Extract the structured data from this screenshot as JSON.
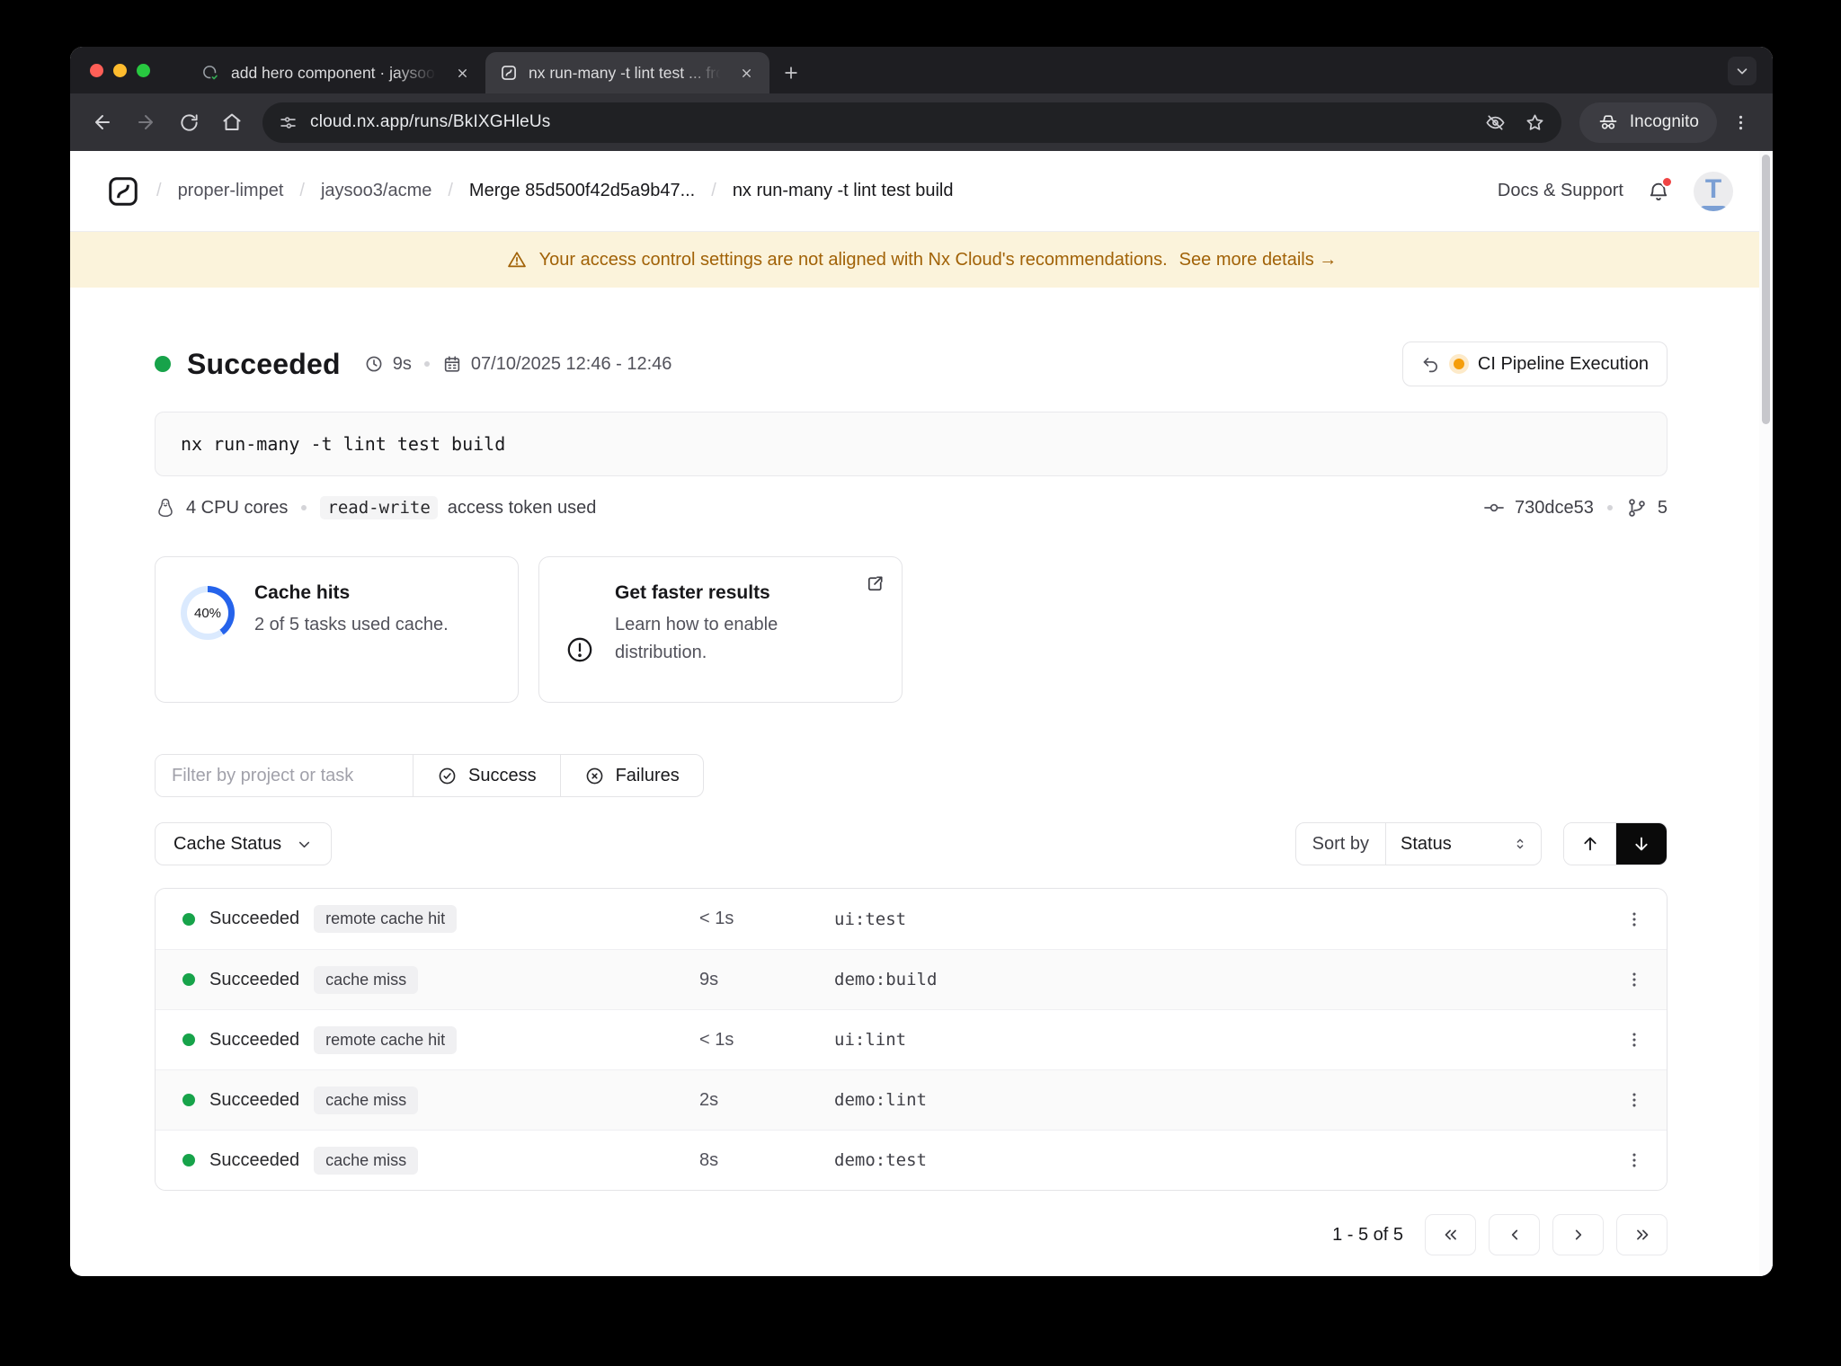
{
  "browser": {
    "tab1": {
      "title": "add hero component · jaysoo"
    },
    "tab2": {
      "title": "nx run-many -t lint test ... fro"
    },
    "url": "cloud.nx.app/runs/BkIXGHleUs",
    "incognito_label": "Incognito"
  },
  "header": {
    "breadcrumbs": [
      "proper-limpet",
      "jaysoo3/acme",
      "Merge 85d500f42d5a9b47...",
      "nx run-many -t lint test build"
    ],
    "docs_support_label": "Docs & Support",
    "avatar_letter": "T"
  },
  "banner": {
    "message": "Your access control settings are not aligned with Nx Cloud's recommendations.",
    "link_label": "See more details →"
  },
  "run": {
    "status_label": "Succeeded",
    "duration": "9s",
    "time_range": "07/10/2025 12:46 - 12:46",
    "pipeline_button_label": "CI Pipeline Execution",
    "command": "nx run-many -t lint test build",
    "cpu_label": "4 CPU cores",
    "token_badge": "read-write",
    "token_text": "access token used",
    "commit_sha": "730dce53",
    "branch_count": "5"
  },
  "cards": {
    "cache": {
      "percent_label": "40%",
      "percent_value": 40,
      "title": "Cache hits",
      "subtitle": "2 of 5 tasks used cache."
    },
    "distribution": {
      "title": "Get faster results",
      "subtitle": "Learn how to enable distribution."
    }
  },
  "filters": {
    "search_placeholder": "Filter by project or task",
    "success_label": "Success",
    "failures_label": "Failures",
    "cache_status_label": "Cache Status",
    "sort_by_label": "Sort by",
    "sort_value": "Status"
  },
  "table": {
    "rows": [
      {
        "status": "Succeeded",
        "cache_status": "remote cache hit",
        "duration": "< 1s",
        "task": "ui:test"
      },
      {
        "status": "Succeeded",
        "cache_status": "cache miss",
        "duration": "9s",
        "task": "demo:build"
      },
      {
        "status": "Succeeded",
        "cache_status": "remote cache hit",
        "duration": "< 1s",
        "task": "ui:lint"
      },
      {
        "status": "Succeeded",
        "cache_status": "cache miss",
        "duration": "2s",
        "task": "demo:lint"
      },
      {
        "status": "Succeeded",
        "cache_status": "cache miss",
        "duration": "8s",
        "task": "demo:test"
      }
    ]
  },
  "pagination": {
    "range_label": "1 - 5 of 5"
  },
  "colors": {
    "success_green": "#17A34A",
    "banner_bg": "#FBF3DB",
    "banner_text": "#A16207",
    "donut_fill": "#2563EB",
    "donut_track": "#DBEAFE",
    "accent_yellow": "#F59E0B",
    "notification_red": "#EF4444",
    "avatar_blue": "#7B9FD4"
  }
}
